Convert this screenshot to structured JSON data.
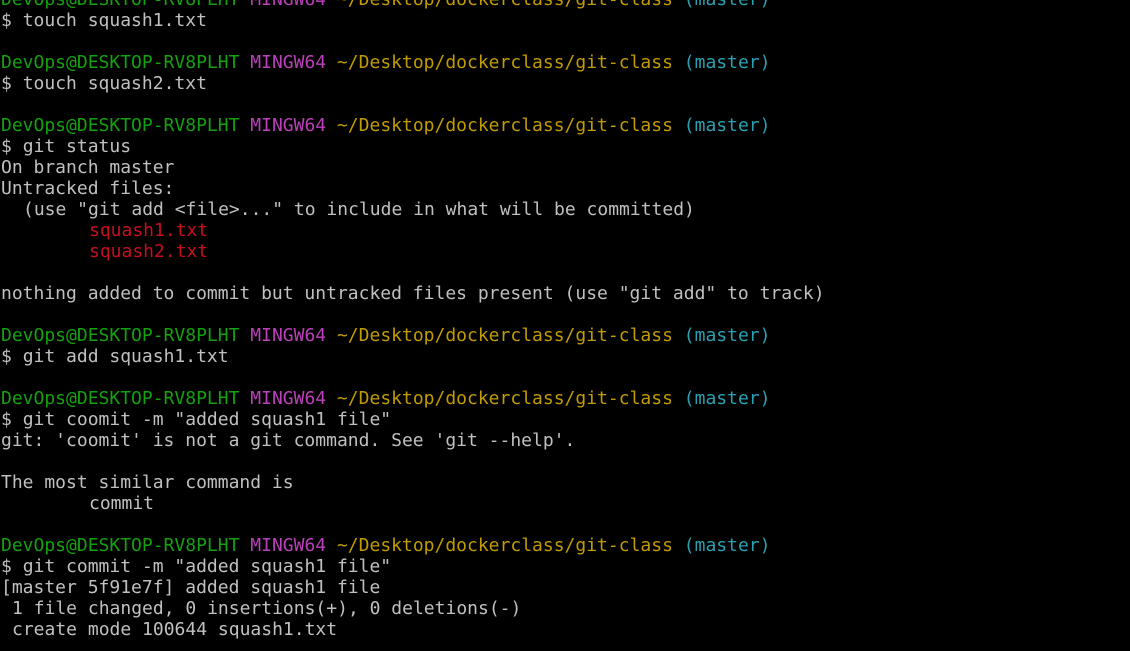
{
  "colors": {
    "background": "#000000",
    "text": "#c0c0c0",
    "user_host": "#13a10e",
    "mingw": "#bc3fbc",
    "path": "#c19c00",
    "branch": "#2aa1b3",
    "untracked": "#c50f1f"
  },
  "prompt": {
    "user_host": "DevOps@DESKTOP-RV8PLHT",
    "system": "MINGW64",
    "path": "~/Desktop/dockerclass/git-class",
    "branch": "(master)",
    "symbol": "$"
  },
  "commands": {
    "c1": "touch squash1.txt",
    "c2": "touch squash2.txt",
    "c3": "git status",
    "c4": "git add squash1.txt",
    "c5": "git coomit -m \"added squash1 file\"",
    "c6": "git commit -m \"added squash1 file\""
  },
  "output": {
    "status_branch": "On branch master",
    "status_untracked_header": "Untracked files:",
    "status_hint": "(use \"git add <file>...\" to include in what will be committed)",
    "untracked_files": [
      "squash1.txt",
      "squash2.txt"
    ],
    "status_footer": "nothing added to commit but untracked files present (use \"git add\" to track)",
    "coomit_error": "git: 'coomit' is not a git command. See 'git --help'.",
    "similar_header": "The most similar command is",
    "similar_command": "commit",
    "commit_summary": "[master 5f91e7f] added squash1 file",
    "commit_stats": "1 file changed, 0 insertions(+), 0 deletions(-)",
    "commit_create": "create mode 100644 squash1.txt"
  }
}
